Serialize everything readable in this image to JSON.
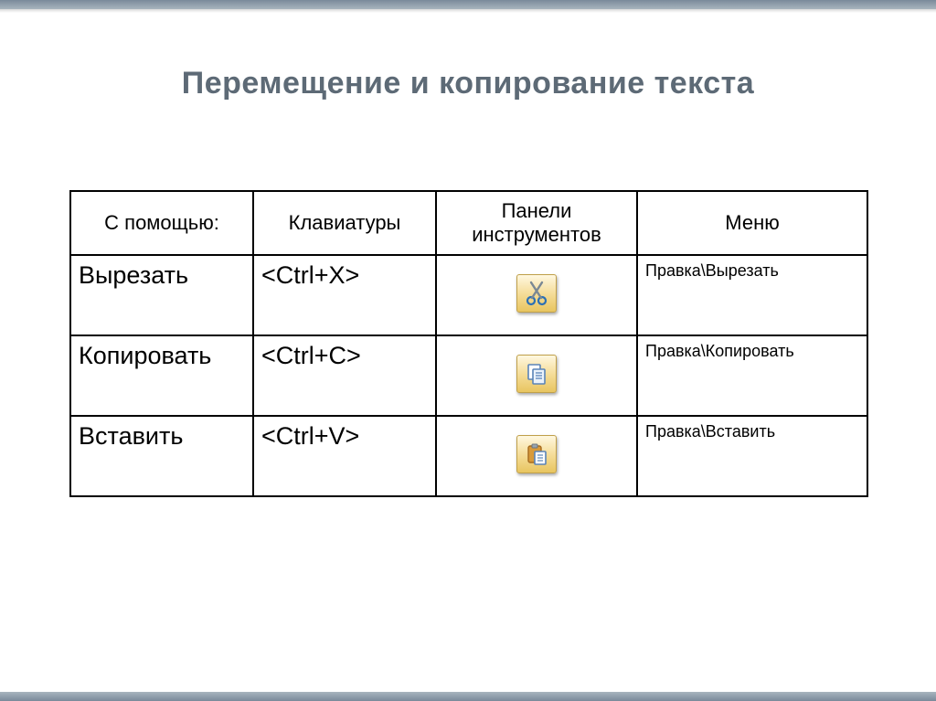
{
  "title": "Перемещение и копирование текста",
  "table": {
    "headers": {
      "with": "С помощью:",
      "keyboard": "Клавиатуры",
      "toolbar": "Панели инструментов",
      "menu": "Меню"
    },
    "rows": [
      {
        "action": "Вырезать",
        "shortcut": "<Ctrl+X>",
        "icon": "cut-icon",
        "menu": "Правка\\Вырезать"
      },
      {
        "action": "Копировать",
        "shortcut": "<Ctrl+C>",
        "icon": "copy-icon",
        "menu": "Правка\\Копировать"
      },
      {
        "action": "Вставить",
        "shortcut": "<Ctrl+V>",
        "icon": "paste-icon",
        "menu": "Правка\\Вставить"
      }
    ]
  }
}
